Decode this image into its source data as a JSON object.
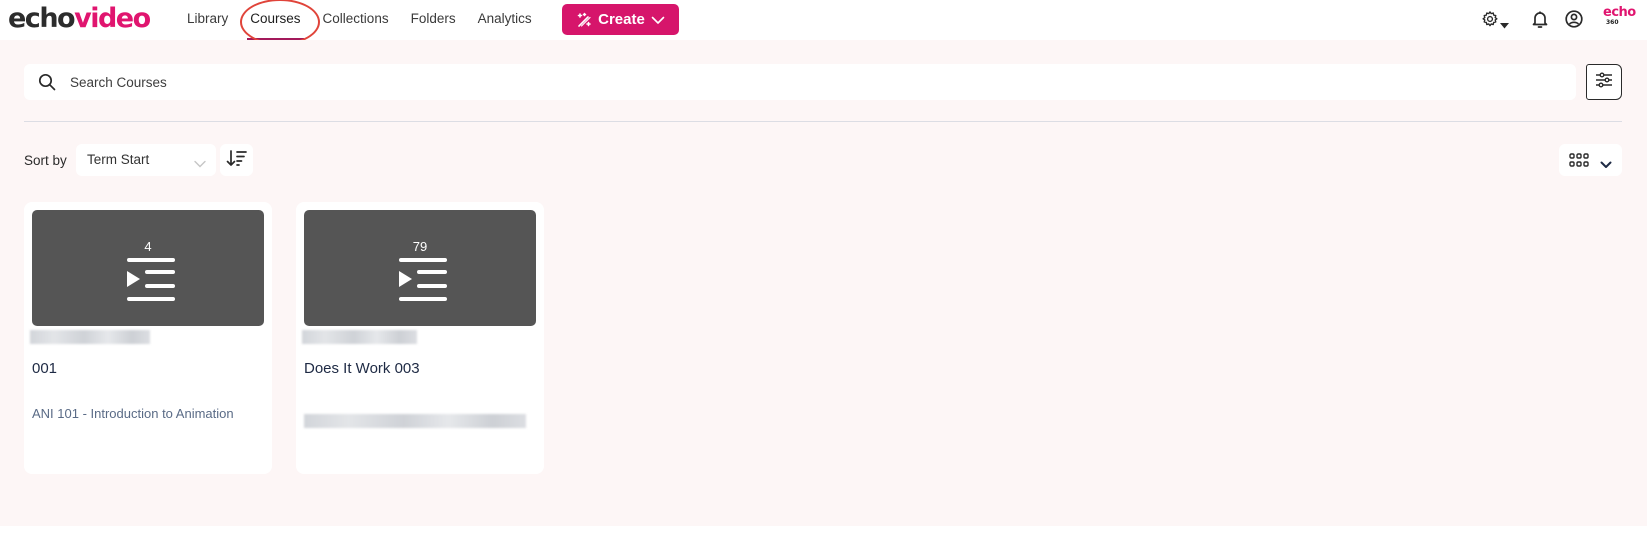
{
  "header": {
    "logo": {
      "part1": "echo",
      "part2": "video"
    },
    "nav": [
      {
        "label": "Library",
        "active": false
      },
      {
        "label": "Courses",
        "active": true
      },
      {
        "label": "Collections",
        "active": false
      },
      {
        "label": "Folders",
        "active": false
      },
      {
        "label": "Analytics",
        "active": false
      }
    ],
    "create_label": "Create",
    "icons": [
      "settings-icon",
      "caret-down-icon",
      "bell-icon",
      "user-icon"
    ],
    "brand": {
      "name": "echo",
      "sub": "360"
    }
  },
  "search": {
    "placeholder": "Search Courses",
    "value": ""
  },
  "sort": {
    "label": "Sort by",
    "selected": "Term Start"
  },
  "colors": {
    "brand": "#d6156b",
    "thumbnail": "#555555",
    "page_bg": "#fdf6f6"
  },
  "courses": [
    {
      "count": "4",
      "title": "001",
      "course_name": "ANI 101 - Introduction to Animation",
      "redacted_subtitle": true
    },
    {
      "count": "79",
      "title": "Does It Work 003",
      "course_name": "",
      "redacted_subtitle": true,
      "redacted_course_name": true
    }
  ]
}
